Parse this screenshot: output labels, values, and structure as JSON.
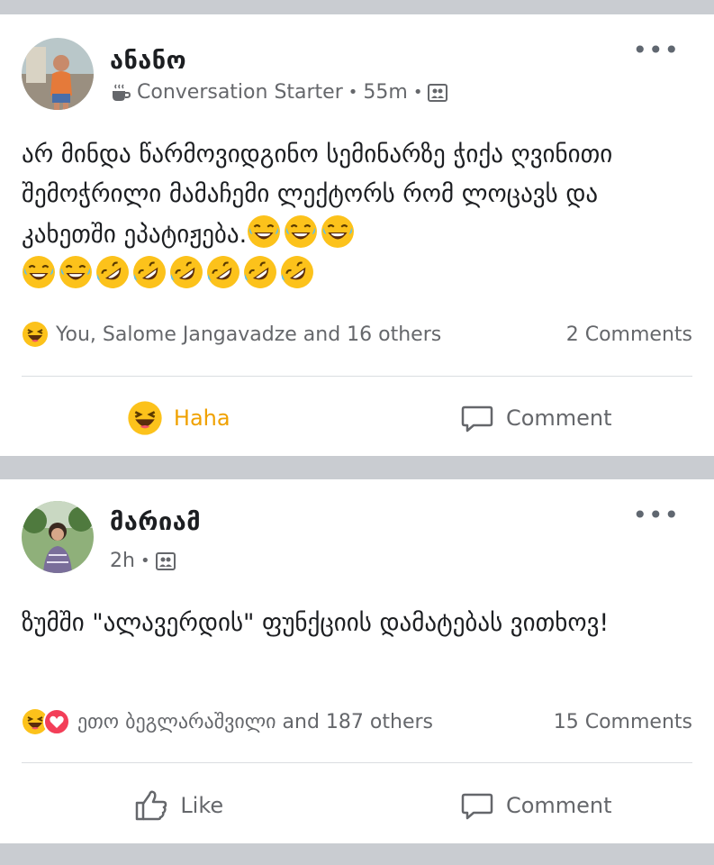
{
  "posts": [
    {
      "author": "ანანო",
      "group_label": "Conversation Starter",
      "time": "55m",
      "text": "არ მინდა წარმოვიდგინო სემინარზე ჭიქა ღვინითი შემოჭრილი მამაჩემი ლექტორს რომ ლოცავს და კახეთში ეპატიჟება.",
      "reaction_summary": "You, Salome Jangavadze and 16 others",
      "comments": "2 Comments",
      "action_left": "Haha",
      "action_right": "Comment"
    },
    {
      "author": "მარიამ",
      "time": "2h",
      "text": "ზუმში \"ალავერდის\" ფუნქციის დამატებას ვითხოვ!",
      "reaction_summary": "ეთო ბეგლარაშვილი and 187 others",
      "comments": "15 Comments",
      "action_left": "Like",
      "action_right": "Comment"
    }
  ],
  "separator_dot": "•",
  "more_label": "•••",
  "colors": {
    "haha_active": "#f0a100",
    "meta_gray": "#65676b",
    "love_red": "#f33e58",
    "emoji_yellow": "#fcc21b"
  },
  "icons": [
    "coffee-cup-icon",
    "audience-icon",
    "laugh-tears-emoji",
    "rofl-emoji",
    "haha-reaction-icon",
    "love-reaction-icon",
    "comment-icon",
    "like-thumb-icon"
  ]
}
